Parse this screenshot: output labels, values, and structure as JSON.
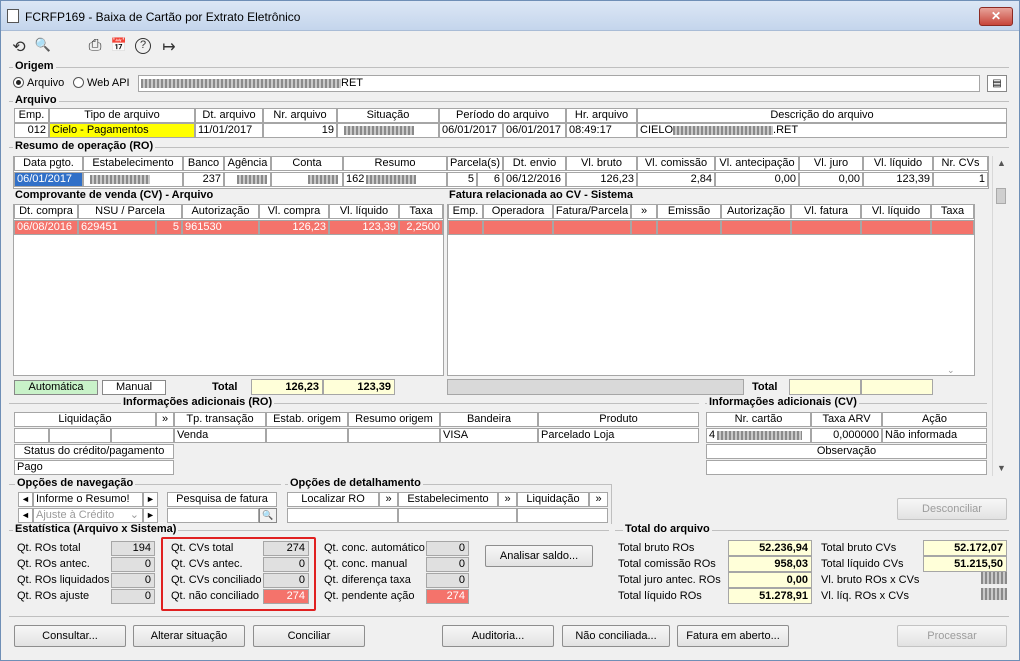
{
  "window": {
    "title": "FCRFP169 - Baixa de Cartão por Extrato Eletrônico",
    "close": "✕"
  },
  "toolbar": {
    "undo": "⟲",
    "search": "🔍",
    "print": "⎙",
    "calendar": "📅",
    "help": "?",
    "exit": "↦"
  },
  "origem": {
    "label": "Origem",
    "opt_arquivo": "Arquivo",
    "opt_webapi": "Web API",
    "path_suffix": "RET"
  },
  "arquivo": {
    "label": "Arquivo",
    "headers": [
      "Emp.",
      "Tipo de arquivo",
      "Dt. arquivo",
      "Nr. arquivo",
      "Situação",
      "Período do arquivo",
      "Hr. arquivo",
      "Descrição do arquivo"
    ],
    "emp": "012",
    "tipo": "Cielo - Pagamentos",
    "dt": "11/01/2017",
    "nr": "19",
    "periodo_ini": "06/01/2017",
    "periodo_fim": "06/01/2017",
    "hr": "08:49:17",
    "desc_prefix": "CIELO",
    "desc_suffix": ".RET"
  },
  "ro": {
    "label": "Resumo de operação (RO)",
    "headers": [
      "Data pgto.",
      "Estabelecimento",
      "Banco",
      "Agência",
      "Conta",
      "Resumo",
      "Parcela(s)",
      "Dt. envio",
      "Vl. bruto",
      "Vl. comissão",
      "Vl. antecipação",
      "Vl. juro",
      "Vl. líquido",
      "Nr. CVs"
    ],
    "data": "06/01/2017",
    "banco": "237",
    "resumo_prefix": "162",
    "parcela_a": "5",
    "parcela_b": "6",
    "envio": "06/12/2016",
    "bruto": "126,23",
    "comissao": "2,84",
    "antecipacao": "0,00",
    "juro": "0,00",
    "liquido": "123,39",
    "nrcvs": "1"
  },
  "cv": {
    "label": "Comprovante de venda (CV) - Arquivo",
    "headers": [
      "Dt. compra",
      "NSU / Parcela",
      "Autorização",
      "Vl. compra",
      "Vl. líquido",
      "Taxa"
    ],
    "row": {
      "dt": "06/08/2016",
      "nsu": "629451",
      "parc": "5",
      "aut": "961530",
      "compra": "126,23",
      "liquido": "123,39",
      "taxa": "2,2500"
    },
    "btn_auto": "Automática",
    "btn_manual": "Manual",
    "total_label": "Total",
    "total_compra": "126,23",
    "total_liquido": "123,39"
  },
  "fatura": {
    "label": "Fatura relacionada ao CV - Sistema",
    "headers": [
      "Emp.",
      "Operadora",
      "Fatura/Parcela",
      "»",
      "Emissão",
      "Autorização",
      "Vl. fatura",
      "Vl. líquido",
      "Taxa"
    ],
    "total_label": "Total"
  },
  "info_ro": {
    "label": "Informações adicionais (RO)",
    "headers": [
      "Liquidação",
      "»",
      "Tp. transação",
      "Estab. origem",
      "Resumo origem",
      "Bandeira",
      "Produto"
    ],
    "tp": "Venda",
    "bandeira": "VISA",
    "produto": "Parcelado Loja",
    "status_label": "Status do crédito/pagamento",
    "status": "Pago"
  },
  "info_cv": {
    "label": "Informações adicionais (CV)",
    "headers": [
      "Nr. cartão",
      "Taxa ARV",
      "Ação"
    ],
    "cartao_prefix": "4",
    "taxa": "0,000000",
    "acao": "Não informada",
    "obs_label": "Observação"
  },
  "nav": {
    "label": "Opções de navegação",
    "sel1": "Informe o Resumo!",
    "sel2": "Ajuste à Crédito",
    "pesquisa": "Pesquisa de fatura"
  },
  "detalhe": {
    "label": "Opções de detalhamento",
    "cols": [
      "Localizar RO",
      "»",
      "Estabelecimento",
      "»",
      "Liquidação",
      "»"
    ]
  },
  "desconciliar": "Desconciliar",
  "estat": {
    "label": "Estatística (Arquivo x Sistema)",
    "c1": [
      [
        "Qt. ROs total",
        "194"
      ],
      [
        "Qt. ROs antec.",
        "0"
      ],
      [
        "Qt. ROs liquidados",
        "0"
      ],
      [
        "Qt. ROs ajuste",
        "0"
      ]
    ],
    "c2": [
      [
        "Qt. CVs total",
        "274"
      ],
      [
        "Qt. CVs antec.",
        "0"
      ],
      [
        "Qt. CVs conciliado",
        "0"
      ],
      [
        "Qt. não conciliado",
        "274"
      ]
    ],
    "c3": [
      [
        "Qt. conc. automático",
        "0"
      ],
      [
        "Qt. conc. manual",
        "0"
      ],
      [
        "Qt. diferença taxa",
        "0"
      ],
      [
        "Qt. pendente ação",
        "274"
      ]
    ],
    "analisar": "Analisar saldo..."
  },
  "total_arquivo": {
    "label": "Total do arquivo",
    "left": [
      [
        "Total bruto ROs",
        "52.236,94"
      ],
      [
        "Total comissão ROs",
        "958,03"
      ],
      [
        "Total juro antec. ROs",
        "0,00"
      ],
      [
        "Total líquido ROs",
        "51.278,91"
      ]
    ],
    "right": [
      [
        "Total bruto CVs",
        "52.172,07"
      ],
      [
        "Total líquido CVs",
        "51.215,50"
      ],
      [
        "Vl. bruto ROs x CVs",
        ""
      ],
      [
        "Vl. líq. ROs x CVs",
        ""
      ]
    ]
  },
  "bottom": {
    "consultar": "Consultar...",
    "alterar": "Alterar situação",
    "conciliar": "Conciliar",
    "auditoria": "Auditoria...",
    "nao_conciliada": "Não conciliada...",
    "fatura_aberto": "Fatura em aberto...",
    "processar": "Processar"
  }
}
